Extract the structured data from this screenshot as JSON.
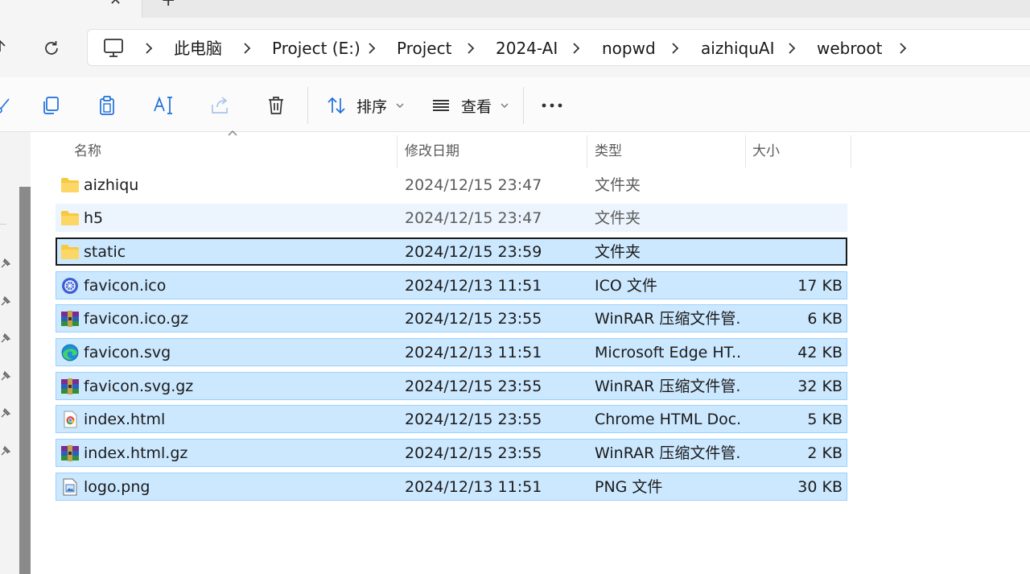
{
  "breadcrumbs": [
    "此电脑",
    "Project (E:)",
    "Project",
    "2024-AI",
    "nopwd",
    "aizhiquAI",
    "webroot"
  ],
  "toolbar": {
    "sort_label": "排序",
    "view_label": "查看"
  },
  "columns": {
    "name": "名称",
    "modified": "修改日期",
    "type": "类型",
    "size": "大小"
  },
  "files": [
    {
      "name": "aizhiqu",
      "modified": "2024/12/15 23:47",
      "type": "文件夹",
      "size": "",
      "icon": "folder-icon",
      "state": "normal"
    },
    {
      "name": "h5",
      "modified": "2024/12/15 23:47",
      "type": "文件夹",
      "size": "",
      "icon": "folder-icon",
      "state": "hover"
    },
    {
      "name": "static",
      "modified": "2024/12/15 23:59",
      "type": "文件夹",
      "size": "",
      "icon": "folder-icon",
      "state": "focus"
    },
    {
      "name": "favicon.ico",
      "modified": "2024/12/13 11:51",
      "type": "ICO 文件",
      "size": "17 KB",
      "icon": "ico-file-icon",
      "state": "selected"
    },
    {
      "name": "favicon.ico.gz",
      "modified": "2024/12/15 23:55",
      "type": "WinRAR 压缩文件管...",
      "size": "6 KB",
      "icon": "winrar-archive-icon",
      "state": "selected"
    },
    {
      "name": "favicon.svg",
      "modified": "2024/12/13 11:51",
      "type": "Microsoft Edge HT...",
      "size": "42 KB",
      "icon": "edge-file-icon",
      "state": "selected"
    },
    {
      "name": "favicon.svg.gz",
      "modified": "2024/12/15 23:55",
      "type": "WinRAR 压缩文件管...",
      "size": "32 KB",
      "icon": "winrar-archive-icon",
      "state": "selected"
    },
    {
      "name": "index.html",
      "modified": "2024/12/15 23:55",
      "type": "Chrome HTML Doc...",
      "size": "5 KB",
      "icon": "chrome-file-icon",
      "state": "selected"
    },
    {
      "name": "index.html.gz",
      "modified": "2024/12/15 23:55",
      "type": "WinRAR 压缩文件管...",
      "size": "2 KB",
      "icon": "winrar-archive-icon",
      "state": "selected"
    },
    {
      "name": "logo.png",
      "modified": "2024/12/13 11:51",
      "type": "PNG 文件",
      "size": "30 KB",
      "icon": "image-file-icon",
      "state": "selected"
    }
  ],
  "colors": {
    "selection": "#cce8ff",
    "selection_border": "#99d1ff",
    "hover": "#ecf4fd",
    "folder": "#f8c93e"
  }
}
